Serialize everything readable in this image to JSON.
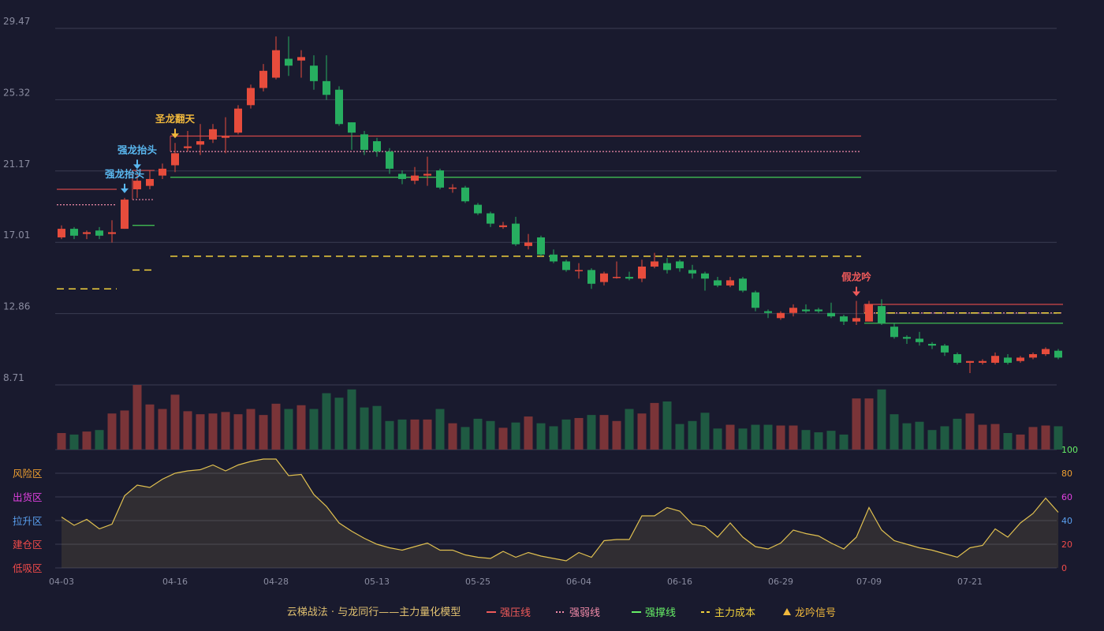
{
  "chart_data": {
    "type": "candlestick",
    "price_axis": {
      "ticks": [
        "29.47",
        "25.32",
        "21.17",
        "17.01",
        "12.86",
        "8.71"
      ],
      "range": [
        8.71,
        29.47
      ]
    },
    "dates": [
      "04-03",
      "04-16",
      "04-28",
      "05-13",
      "05-25",
      "06-04",
      "06-16",
      "06-29",
      "07-09",
      "07-21"
    ],
    "date_index": [
      0,
      9,
      17,
      25,
      33,
      41,
      49,
      57,
      64,
      72
    ],
    "candles": [
      [
        17.3,
        17.8,
        17.2,
        18.0
      ],
      [
        17.8,
        17.4,
        17.2,
        17.9
      ],
      [
        17.5,
        17.6,
        17.2,
        17.7
      ],
      [
        17.7,
        17.4,
        17.2,
        17.9
      ],
      [
        17.5,
        17.6,
        17.0,
        18.3
      ],
      [
        17.8,
        19.5,
        17.8,
        19.6
      ],
      [
        20.1,
        20.6,
        19.6,
        21.0
      ],
      [
        20.3,
        20.7,
        20.1,
        21.2
      ],
      [
        20.9,
        21.3,
        20.7,
        21.6
      ],
      [
        21.5,
        22.2,
        21.1,
        22.8
      ],
      [
        22.5,
        22.6,
        22.3,
        23.5
      ],
      [
        22.7,
        22.9,
        22.1,
        23.9
      ],
      [
        23.0,
        23.6,
        22.8,
        23.9
      ],
      [
        23.1,
        23.2,
        22.2,
        24.3
      ],
      [
        23.4,
        24.8,
        23.3,
        25.0
      ],
      [
        25.0,
        26.0,
        24.8,
        26.2
      ],
      [
        26.0,
        27.0,
        25.8,
        27.4
      ],
      [
        26.6,
        28.2,
        26.5,
        29.0
      ],
      [
        27.7,
        27.3,
        26.7,
        29.0
      ],
      [
        27.6,
        27.8,
        26.6,
        28.2
      ],
      [
        27.3,
        26.4,
        25.9,
        27.9
      ],
      [
        26.4,
        25.6,
        25.3,
        27.9
      ],
      [
        25.9,
        23.9,
        23.8,
        26.1
      ],
      [
        24.0,
        23.4,
        22.4,
        24.0
      ],
      [
        23.3,
        22.4,
        22.1,
        23.5
      ],
      [
        22.9,
        22.3,
        22.0,
        23.1
      ],
      [
        22.3,
        21.3,
        21.0,
        22.5
      ],
      [
        21.0,
        20.7,
        20.4,
        21.2
      ],
      [
        20.6,
        20.9,
        20.4,
        21.4
      ],
      [
        20.9,
        21.0,
        20.3,
        22.0
      ],
      [
        21.2,
        20.2,
        20.1,
        21.3
      ],
      [
        20.2,
        20.2,
        19.9,
        20.4
      ],
      [
        20.2,
        19.4,
        19.3,
        20.3
      ],
      [
        19.2,
        18.7,
        18.6,
        19.3
      ],
      [
        18.7,
        18.1,
        17.9,
        18.8
      ],
      [
        17.9,
        18.0,
        17.8,
        18.2
      ],
      [
        18.1,
        16.9,
        16.8,
        18.5
      ],
      [
        16.8,
        17.0,
        16.6,
        17.5
      ],
      [
        17.3,
        16.3,
        16.2,
        17.4
      ],
      [
        16.3,
        15.9,
        15.8,
        16.6
      ],
      [
        15.9,
        15.4,
        15.3,
        16.0
      ],
      [
        15.4,
        15.4,
        14.9,
        15.8
      ],
      [
        15.4,
        14.6,
        14.3,
        15.5
      ],
      [
        14.7,
        15.2,
        14.5,
        15.3
      ],
      [
        15.0,
        15.0,
        14.9,
        15.9
      ],
      [
        15.0,
        14.9,
        14.8,
        15.3
      ],
      [
        14.9,
        15.6,
        14.7,
        16.0
      ],
      [
        15.6,
        15.9,
        15.5,
        16.4
      ],
      [
        15.8,
        15.4,
        15.2,
        16.1
      ],
      [
        15.9,
        15.5,
        15.3,
        16.0
      ],
      [
        15.4,
        15.2,
        14.9,
        15.7
      ],
      [
        15.2,
        14.9,
        14.2,
        15.3
      ],
      [
        14.8,
        14.5,
        14.4,
        15.0
      ],
      [
        14.5,
        14.8,
        14.4,
        15.0
      ],
      [
        14.9,
        14.2,
        14.1,
        15.0
      ],
      [
        14.1,
        13.2,
        13.0,
        14.2
      ],
      [
        13.0,
        12.9,
        12.6,
        13.1
      ],
      [
        12.6,
        12.9,
        12.5,
        13.0
      ],
      [
        12.9,
        13.2,
        12.7,
        13.4
      ],
      [
        13.1,
        13.0,
        12.9,
        13.4
      ],
      [
        13.1,
        13.0,
        12.9,
        13.2
      ],
      [
        12.9,
        12.7,
        12.6,
        13.5
      ],
      [
        12.7,
        12.4,
        12.2,
        12.8
      ],
      [
        12.4,
        12.6,
        12.2,
        13.6
      ],
      [
        12.4,
        13.4,
        12.4,
        13.6
      ],
      [
        13.3,
        12.3,
        12.2,
        13.7
      ],
      [
        12.1,
        11.5,
        11.4,
        12.3
      ],
      [
        11.5,
        11.4,
        11.1,
        11.6
      ],
      [
        11.4,
        11.2,
        11.0,
        11.8
      ],
      [
        11.1,
        11.0,
        10.8,
        11.2
      ],
      [
        11.0,
        10.6,
        10.4,
        11.1
      ],
      [
        10.5,
        10.0,
        9.9,
        10.6
      ],
      [
        10.0,
        10.1,
        9.4,
        10.1
      ],
      [
        10.0,
        10.1,
        9.9,
        10.2
      ],
      [
        10.0,
        10.4,
        9.9,
        10.6
      ],
      [
        10.3,
        10.0,
        9.9,
        10.5
      ],
      [
        10.1,
        10.3,
        10.0,
        10.4
      ],
      [
        10.3,
        10.5,
        10.2,
        10.6
      ],
      [
        10.5,
        10.8,
        10.4,
        10.9
      ],
      [
        10.7,
        10.3,
        10.2,
        10.8
      ]
    ],
    "volume": [
      22,
      20,
      24,
      26,
      48,
      52,
      86,
      60,
      54,
      73,
      51,
      47,
      48,
      50,
      47,
      54,
      46,
      61,
      54,
      59,
      54,
      75,
      69,
      80,
      56,
      58,
      38,
      40,
      40,
      40,
      54,
      35,
      30,
      41,
      38,
      29,
      36,
      44,
      35,
      31,
      40,
      42,
      46,
      46,
      38,
      54,
      48,
      62,
      64,
      34,
      38,
      49,
      28,
      33,
      28,
      33,
      33,
      32,
      32,
      26,
      23,
      25,
      20,
      68,
      68,
      80,
      47,
      35,
      37,
      26,
      31,
      41,
      48,
      33,
      34,
      22,
      20,
      30,
      32,
      31
    ],
    "volume_max": 86,
    "oscillator": {
      "axis_ticks": [
        "100",
        "80",
        "60",
        "40",
        "20",
        "0"
      ],
      "zones": [
        "风险区",
        "出货区",
        "拉升区",
        "建仓区",
        "低吸区"
      ],
      "values": [
        43,
        36,
        41,
        33,
        37,
        61,
        70,
        68,
        75,
        80,
        82,
        83,
        87,
        82,
        87,
        90,
        92,
        92,
        78,
        79,
        62,
        52,
        38,
        31,
        25,
        20,
        17,
        15,
        18,
        21,
        15,
        15,
        11,
        9,
        8,
        14,
        9,
        13,
        10,
        8,
        6,
        13,
        9,
        23,
        24,
        24,
        44,
        44,
        51,
        48,
        37,
        35,
        26,
        38,
        26,
        18,
        16,
        21,
        32,
        29,
        27,
        21,
        16,
        26,
        51,
        32,
        23,
        20,
        17,
        15,
        12,
        9,
        17,
        19,
        33,
        26,
        38,
        46,
        59,
        47
      ]
    },
    "signals": [
      {
        "index": 5,
        "label": "强龙抬头",
        "color": "#5ab8f0"
      },
      {
        "index": 6,
        "label": "强龙抬头",
        "color": "#5ab8f0"
      },
      {
        "index": 9,
        "label": "圣龙翻天",
        "color": "#f0b83c"
      },
      {
        "index": 63,
        "label": "假龙吟",
        "color": "#f05a5a"
      }
    ],
    "levels": [
      {
        "from": 0,
        "to": 4,
        "strong_pressure": 20.1,
        "weak": 19.2,
        "support": null,
        "cost": 14.3
      },
      {
        "from": 6,
        "to": 7,
        "strong_pressure": 21.2,
        "weak": 19.5,
        "support": 18.0,
        "cost": 15.4
      },
      {
        "from": 9,
        "to": 63,
        "strong_pressure": 23.2,
        "weak": 22.3,
        "support": 20.8,
        "cost": 16.2
      },
      {
        "from": 64,
        "to": 79,
        "strong_pressure": 13.4,
        "weak": 12.9,
        "support": 12.3,
        "cost": 12.9
      }
    ]
  },
  "legend": {
    "title": "云梯战法 · 与龙同行——主力量化模型",
    "items": [
      {
        "label": "强压线",
        "color": "#f05a5a",
        "style": "solid"
      },
      {
        "label": "强弱线",
        "color": "#f08aa8",
        "style": "dotted"
      },
      {
        "label": "强撑线",
        "color": "#66ee66",
        "style": "solid"
      },
      {
        "label": "主力成本",
        "color": "#f0d03c",
        "style": "dashed"
      },
      {
        "label": "龙吟信号",
        "color": "#f0b83c",
        "style": "triangle"
      }
    ]
  },
  "colors": {
    "up": "#e74c3c",
    "down": "#27ae60",
    "vol_up": "#7a3438",
    "vol_down": "#1f5a42",
    "osc_line": "#e0c050",
    "grid": "#3a3c52",
    "axis_text": "#8a8ca0",
    "zone_colors": [
      "#f0a030",
      "#e040e0",
      "#5aa0f0",
      "#f04a4a",
      "#f04a4a"
    ],
    "osc_tick_colors": [
      "#66ee66",
      "#f0a030",
      "#e040e0",
      "#5aa0f0",
      "#f04a4a",
      "#f04a4a"
    ]
  }
}
